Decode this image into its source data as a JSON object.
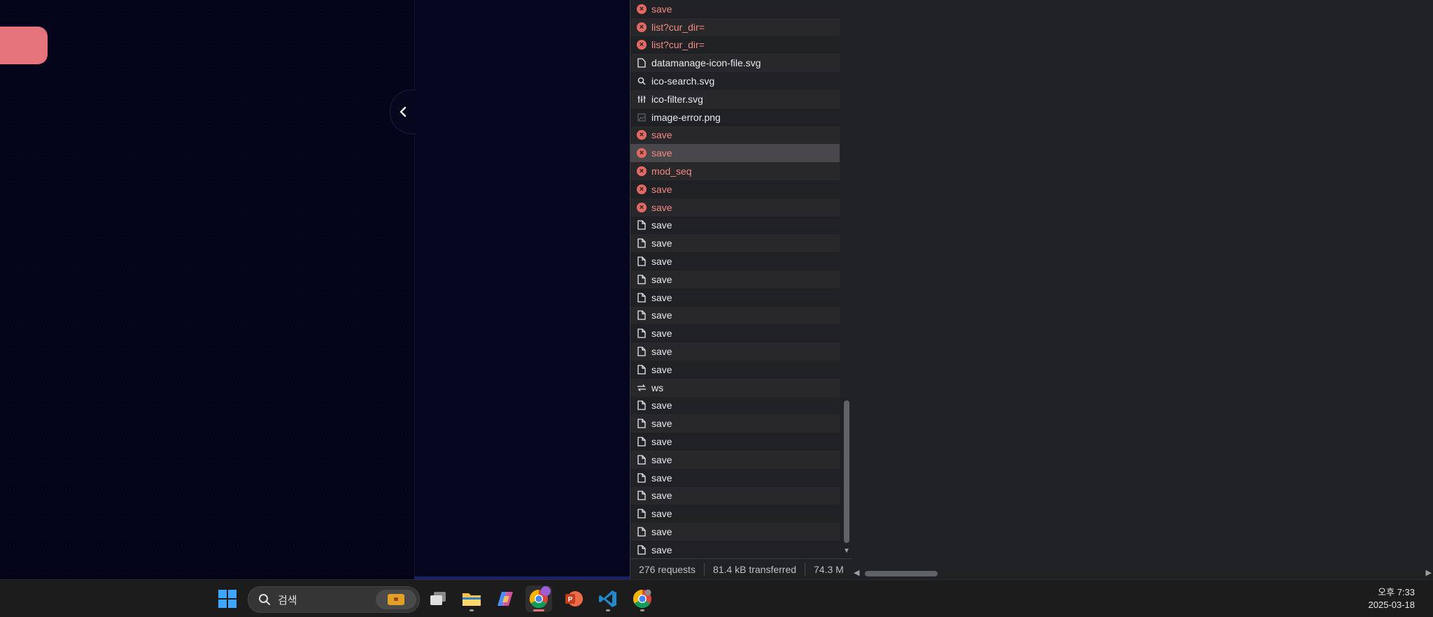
{
  "network": {
    "rows": [
      {
        "name": "save",
        "icon": "error-icon",
        "error": true
      },
      {
        "name": "list?cur_dir=",
        "icon": "error-icon",
        "error": true
      },
      {
        "name": "list?cur_dir=",
        "icon": "error-icon",
        "error": true
      },
      {
        "name": "datamanage-icon-file.svg",
        "icon": "file-icon",
        "error": false
      },
      {
        "name": "ico-search.svg",
        "icon": "search-icon",
        "error": false
      },
      {
        "name": "ico-filter.svg",
        "icon": "filter-icon",
        "error": false
      },
      {
        "name": "image-error.png",
        "icon": "image-icon",
        "error": false
      },
      {
        "name": "save",
        "icon": "error-icon",
        "error": true
      },
      {
        "name": "save",
        "icon": "error-icon",
        "error": true,
        "selected": true
      },
      {
        "name": "mod_seq",
        "icon": "error-icon",
        "error": true
      },
      {
        "name": "save",
        "icon": "error-icon",
        "error": true
      },
      {
        "name": "save",
        "icon": "error-icon",
        "error": true
      },
      {
        "name": "save",
        "icon": "document-icon",
        "error": false
      },
      {
        "name": "save",
        "icon": "document-icon",
        "error": false
      },
      {
        "name": "save",
        "icon": "document-icon",
        "error": false
      },
      {
        "name": "save",
        "icon": "document-icon",
        "error": false
      },
      {
        "name": "save",
        "icon": "document-icon",
        "error": false
      },
      {
        "name": "save",
        "icon": "document-icon",
        "error": false
      },
      {
        "name": "save",
        "icon": "document-icon",
        "error": false
      },
      {
        "name": "save",
        "icon": "document-icon",
        "error": false
      },
      {
        "name": "save",
        "icon": "document-icon",
        "error": false
      },
      {
        "name": "ws",
        "icon": "websocket-icon",
        "error": false
      },
      {
        "name": "save",
        "icon": "document-icon",
        "error": false
      },
      {
        "name": "save",
        "icon": "document-icon",
        "error": false
      },
      {
        "name": "save",
        "icon": "document-icon",
        "error": false
      },
      {
        "name": "save",
        "icon": "document-icon",
        "error": false
      },
      {
        "name": "save",
        "icon": "document-icon",
        "error": false
      },
      {
        "name": "save",
        "icon": "document-icon",
        "error": false
      },
      {
        "name": "save",
        "icon": "document-icon",
        "error": false
      },
      {
        "name": "save",
        "icon": "document-icon",
        "error": false
      },
      {
        "name": "save",
        "icon": "document-icon",
        "error": false
      }
    ],
    "status": {
      "requests": "276 requests",
      "transferred": "81.4 kB transferred",
      "resources": "74.3 M"
    }
  },
  "taskbar": {
    "search_placeholder": "검색",
    "clock_time": "오후 7:33",
    "clock_date": "2025-03-18"
  },
  "colors": {
    "accent_pink": "#e5737b",
    "error_red": "#f28b82",
    "panel_bg": "#202124",
    "app_bg": "#03031a"
  }
}
